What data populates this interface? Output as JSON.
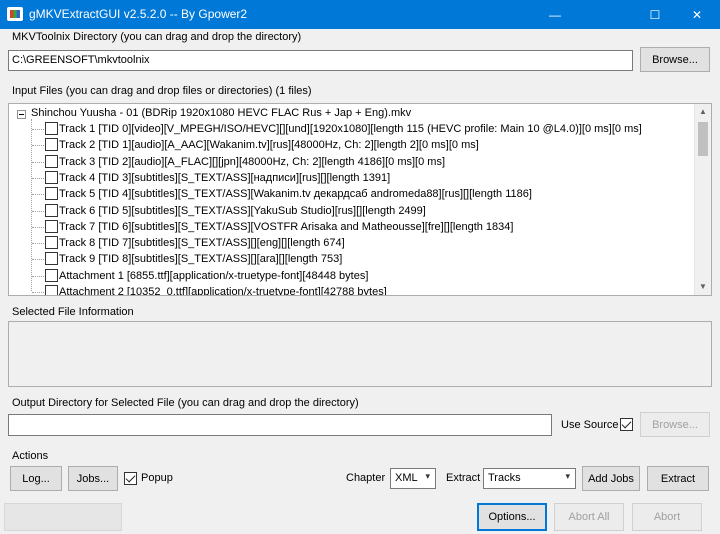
{
  "window": {
    "title": "gMKVExtractGUI v2.5.2.0 -- By Gpower2",
    "controls": {
      "minimize": "—",
      "maximize": "☐",
      "close": "✕"
    }
  },
  "mkvtoolnix": {
    "label": "MKVToolnix Directory (you can drag and drop the directory)",
    "path": "C:\\GREENSOFT\\mkvtoolnix",
    "browse": "Browse..."
  },
  "input": {
    "label": "Input Files (you can drag and drop files or directories) (1 files)",
    "file": "Shinchou Yuusha - 01 (BDRip 1920x1080 HEVC FLAC Rus + Jap + Eng).mkv",
    "tracks": [
      {
        "label": "Track 1 [TID 0][video][V_MPEGH/ISO/HEVC][][und][1920x1080][length 115 (HEVC profile: Main 10 @L4.0)][0 ms][0 ms]",
        "checked": false
      },
      {
        "label": "Track 2 [TID 1][audio][A_AAC][Wakanim.tv][rus][48000Hz, Ch: 2][length 2][0 ms][0 ms]",
        "checked": false
      },
      {
        "label": "Track 3 [TID 2][audio][A_FLAC][][jpn][48000Hz, Ch: 2][length 4186][0 ms][0 ms]",
        "checked": false
      },
      {
        "label": "Track 4 [TID 3][subtitles][S_TEXT/ASS][надписи][rus][][length 1391]",
        "checked": false
      },
      {
        "label": "Track 5 [TID 4][subtitles][S_TEXT/ASS][Wakanim.tv декардсаб andromeda88][rus][][length 1186]",
        "checked": false
      },
      {
        "label": "Track 6 [TID 5][subtitles][S_TEXT/ASS][YakuSub Studio][rus][][length 2499]",
        "checked": false
      },
      {
        "label": "Track 7 [TID 6][subtitles][S_TEXT/ASS][VOSTFR Arisaka and Matheousse][fre][][length 1834]",
        "checked": false
      },
      {
        "label": "Track 8 [TID 7][subtitles][S_TEXT/ASS][][eng][][length 674]",
        "checked": false
      },
      {
        "label": "Track 9 [TID 8][subtitles][S_TEXT/ASS][][ara][][length 753]",
        "checked": false
      },
      {
        "label": "Attachment 1 [6855.ttf][application/x-truetype-font][48448 bytes]",
        "checked": false
      },
      {
        "label": "Attachment 2 [10352_0.ttf][application/x-truetype-font][42788 bytes]",
        "checked": false
      }
    ]
  },
  "selected_info": {
    "label": "Selected File Information"
  },
  "output": {
    "label": "Output Directory for Selected File (you can drag and drop the directory)",
    "path": "",
    "use_source_label": "Use Source",
    "use_source_checked": true,
    "browse": "Browse..."
  },
  "actions": {
    "label": "Actions",
    "log": "Log...",
    "jobs": "Jobs...",
    "popup_label": "Popup",
    "popup_checked": true,
    "chapter_label": "Chapter",
    "chapter_value": "XML",
    "extract_label": "Extract",
    "extract_value": "Tracks",
    "add_jobs": "Add Jobs",
    "extract_button": "Extract"
  },
  "bottom": {
    "options": "Options...",
    "abort_all": "Abort All",
    "abort": "Abort"
  }
}
